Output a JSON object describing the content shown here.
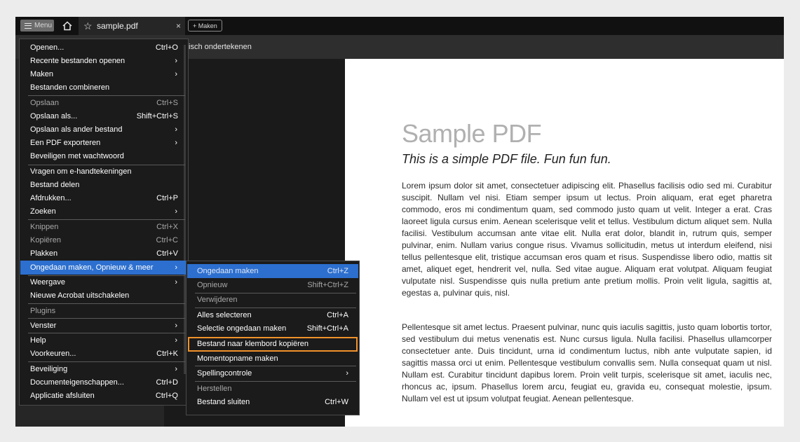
{
  "app": {
    "menu_button": "Menu",
    "tab_title": "sample.pdf",
    "tab_close": "×",
    "new_tab": "+ Maken",
    "toolbar_text": "isch ondertekenen"
  },
  "document": {
    "title": "Sample PDF",
    "subtitle": "This is a simple PDF file. Fun fun fun.",
    "paragraphs": [
      "Lorem ipsum dolor sit amet, consectetuer adipiscing elit. Phasellus facilisis odio sed mi. Curabitur suscipit. Nullam vel nisi. Etiam semper ipsum ut lectus. Proin aliquam, erat eget pharetra commodo, eros mi condimentum quam, sed commodo justo quam ut velit. Integer a erat. Cras laoreet ligula cursus enim. Aenean scelerisque velit et tellus. Vestibulum dictum aliquet sem. Nulla facilisi. Vestibulum accumsan ante vitae elit. Nulla erat dolor, blandit in, rutrum quis, semper pulvinar, enim. Nullam varius congue risus. Vivamus sollicitudin, metus ut interdum eleifend, nisi tellus pellentesque elit, tristique accumsan eros quam et risus. Suspendisse libero odio, mattis sit amet, aliquet eget, hendrerit vel, nulla. Sed vitae augue. Aliquam erat volutpat. Aliquam feugiat vulputate nisl. Suspendisse quis nulla pretium ante pretium mollis. Proin velit ligula, sagittis at, egestas a, pulvinar quis, nisl.",
      "Pellentesque sit amet lectus. Praesent pulvinar, nunc quis iaculis sagittis, justo quam lobortis tortor, sed vestibulum dui metus venenatis est. Nunc cursus ligula. Nulla facilisi. Phasellus ullamcorper consectetuer ante. Duis tincidunt, urna id condimentum luctus, nibh ante vulputate sapien, id sagittis massa orci ut enim. Pellentesque vestibulum convallis sem. Nulla consequat quam ut nisl. Nullam est. Curabitur tincidunt dapibus lorem. Proin velit turpis, scelerisque sit amet, iaculis nec, rhoncus ac, ipsum. Phasellus lorem arcu, feugiat eu, gravida eu, consequat molestie, ipsum. Nullam vel est ut ipsum volutpat feugiat. Aenean pellentesque."
    ]
  },
  "main_menu": {
    "items": [
      {
        "label": "Openen...",
        "shortcut": "Ctrl+O"
      },
      {
        "label": "Recente bestanden openen",
        "submenu": true
      },
      {
        "label": "Maken",
        "submenu": true
      },
      {
        "label": "Bestanden combineren"
      },
      {
        "label": "Opslaan",
        "shortcut": "Ctrl+S",
        "disabled": true
      },
      {
        "label": "Opslaan als...",
        "shortcut": "Shift+Ctrl+S"
      },
      {
        "label": "Opslaan als ander bestand",
        "submenu": true
      },
      {
        "label": "Een PDF exporteren",
        "submenu": true
      },
      {
        "label": "Beveiligen met wachtwoord"
      },
      {
        "label": "Vragen om e-handtekeningen"
      },
      {
        "label": "Bestand delen"
      },
      {
        "label": "Afdrukken...",
        "shortcut": "Ctrl+P"
      },
      {
        "label": "Zoeken",
        "submenu": true
      },
      {
        "label": "Knippen",
        "shortcut": "Ctrl+X",
        "disabled": true
      },
      {
        "label": "Kopiëren",
        "shortcut": "Ctrl+C",
        "disabled": true
      },
      {
        "label": "Plakken",
        "shortcut": "Ctrl+V"
      },
      {
        "label": "Ongedaan maken, Opnieuw & meer",
        "submenu": true,
        "highlighted": true
      },
      {
        "label": "Weergave",
        "submenu": true
      },
      {
        "label": "Nieuwe Acrobat uitschakelen"
      },
      {
        "label": "Plugins",
        "disabled": true
      },
      {
        "label": "Venster",
        "submenu": true
      },
      {
        "label": "Help",
        "submenu": true
      },
      {
        "label": "Voorkeuren...",
        "shortcut": "Ctrl+K"
      },
      {
        "label": "Beveiliging",
        "submenu": true
      },
      {
        "label": "Documenteigenschappen...",
        "shortcut": "Ctrl+D"
      },
      {
        "label": "Applicatie afsluiten",
        "shortcut": "Ctrl+Q"
      }
    ]
  },
  "sub_menu": {
    "items": [
      {
        "label": "Ongedaan maken",
        "shortcut": "Ctrl+Z",
        "disabled": true,
        "highlighted": true
      },
      {
        "label": "Opnieuw",
        "shortcut": "Shift+Ctrl+Z",
        "disabled": true
      },
      {
        "label": "Verwijderen",
        "disabled": true
      },
      {
        "label": "Alles selecteren",
        "shortcut": "Ctrl+A"
      },
      {
        "label": "Selectie ongedaan maken",
        "shortcut": "Shift+Ctrl+A"
      },
      {
        "label": "Bestand naar klembord kopiëren",
        "focused": true
      },
      {
        "label": "Momentopname maken"
      },
      {
        "label": "Spellingcontrole",
        "submenu": true
      },
      {
        "label": "Herstellen",
        "disabled": true
      },
      {
        "label": "Bestand sluiten",
        "shortcut": "Ctrl+W"
      }
    ]
  },
  "colors": {
    "highlight": "#2c6fcf",
    "focus_outline": "#f0922b",
    "menu_background": "#1b1b1b"
  }
}
